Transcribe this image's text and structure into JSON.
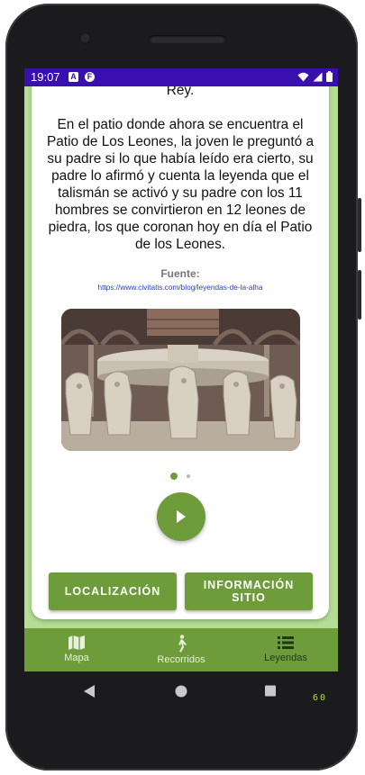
{
  "status_bar": {
    "time": "19:07",
    "notification_icons": [
      "a-icon",
      "f-icon"
    ],
    "right_icons": [
      "wifi-icon",
      "signal-icon",
      "battery-icon"
    ]
  },
  "story": {
    "text": "de la verdad, una maldición caería sobre el Rey.\n\nEn el patio donde ahora se encuentra el Patio de Los Leones, la joven le preguntó a su padre si lo que había leído era cierto, su padre lo afirmó y cuenta la leyenda que el talismán se activó y su padre con los 11 hombres se convirtieron en 12 leones de piedra, los que coronan hoy en día el Patio de los Leones."
  },
  "source": {
    "label": "Fuente:",
    "link": "https://www.civitatis.com/blog/leyendas-de-la-alha"
  },
  "carousel": {
    "image_description_icon": "fountain-lions-photo",
    "page_count": 2,
    "active_index": 0
  },
  "buttons": {
    "location": "LOCALIZACIÓN",
    "site_info": "INFORMACIÓN\nSITIO"
  },
  "bottom_nav": {
    "items": [
      {
        "label": "Mapa",
        "icon": "map-icon"
      },
      {
        "label": "Recorridos",
        "icon": "walk-icon"
      },
      {
        "label": "Leyendas",
        "icon": "list-icon",
        "active": true
      }
    ]
  },
  "debug": {
    "fps": "60"
  },
  "colors": {
    "accent": "#6e9c3a",
    "screen_bg": "#b5dd94",
    "status_bar": "#3a0fb0",
    "link": "#2b3fb5"
  }
}
